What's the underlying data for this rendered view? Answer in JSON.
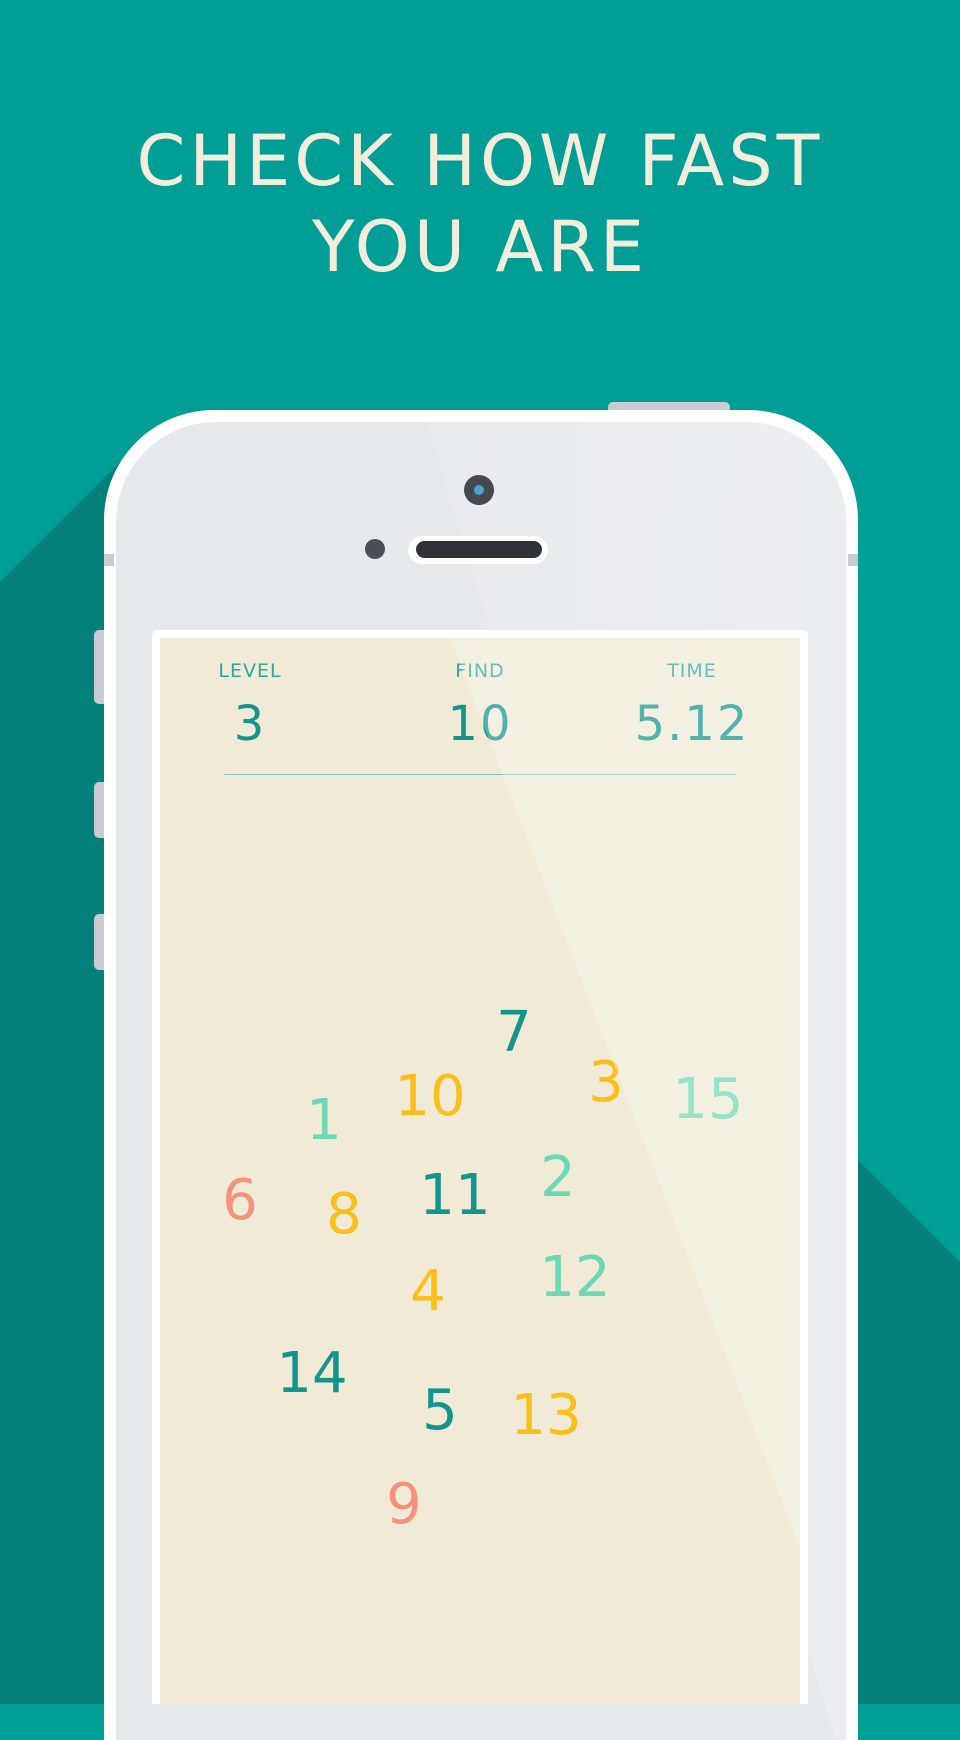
{
  "headline": {
    "line1": "CHECK HOW FAST",
    "line2": "YOU ARE"
  },
  "hud": {
    "level_label": "LEVEL",
    "level_value": "3",
    "find_label": "FIND",
    "find_value": "10",
    "time_label": "TIME",
    "time_value": "5.12"
  },
  "colors": {
    "background": "#019e96",
    "teal": "#13958d",
    "mint": "#6bd9b3",
    "yellow": "#fbbf1b",
    "salmon": "#f4937c",
    "paper": "#f0ead6"
  },
  "numbers": [
    {
      "value": "7",
      "color": "teal"
    },
    {
      "value": "3",
      "color": "yellow"
    },
    {
      "value": "15",
      "color": "mint"
    },
    {
      "value": "10",
      "color": "yellow"
    },
    {
      "value": "1",
      "color": "mint"
    },
    {
      "value": "2",
      "color": "mint"
    },
    {
      "value": "6",
      "color": "salmon"
    },
    {
      "value": "11",
      "color": "teal"
    },
    {
      "value": "8",
      "color": "yellow"
    },
    {
      "value": "12",
      "color": "mint"
    },
    {
      "value": "4",
      "color": "yellow"
    },
    {
      "value": "14",
      "color": "teal"
    },
    {
      "value": "5",
      "color": "teal"
    },
    {
      "value": "13",
      "color": "yellow"
    },
    {
      "value": "9",
      "color": "salmon"
    }
  ]
}
